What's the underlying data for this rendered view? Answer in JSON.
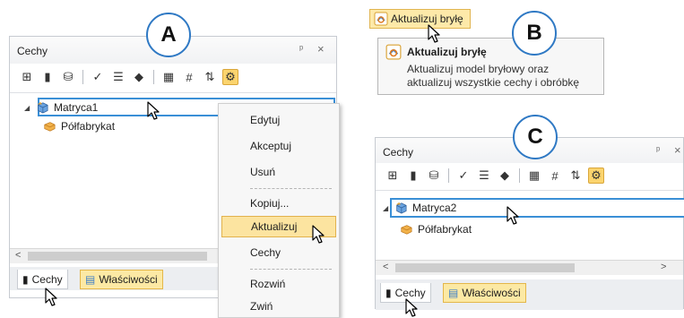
{
  "labels": {
    "a": "A",
    "b": "B",
    "c": "C"
  },
  "panel_a": {
    "title": "Cechy",
    "pin": "ᵖ",
    "close": "×",
    "tree": [
      {
        "label": "Matryca1",
        "icon": "solid-model-icon",
        "selected": true
      },
      {
        "label": "Półfabrykat",
        "icon": "blank-icon",
        "selected": false
      }
    ],
    "scroll_left": "<",
    "tabs": [
      {
        "label": "Cechy",
        "active": true
      },
      {
        "label": "Właściwości",
        "active": false
      }
    ]
  },
  "context_menu": {
    "items": [
      "Edytuj",
      "Akceptuj",
      "Usuń",
      "Kopiuj...",
      "Aktualizuj",
      "Cechy",
      "Rozwiń",
      "Zwiń"
    ],
    "highlighted": "Aktualizuj"
  },
  "button_b": {
    "label": "Aktualizuj bryłę",
    "icon": "update-solid-icon"
  },
  "tooltip": {
    "title": "Aktualizuj bryłę",
    "line1": "Aktualizuj model bryłowy oraz",
    "line2": "aktualizuj wszystkie cechy i obróbkę"
  },
  "panel_c": {
    "title": "Cechy",
    "pin": "ᵖ",
    "close": "×",
    "tree": [
      {
        "label": "Matryca2",
        "icon": "solid-model-icon",
        "selected": true
      },
      {
        "label": "Półfabrykat",
        "icon": "blank-icon",
        "selected": false
      }
    ],
    "scroll_left": "<",
    "scroll_right": ">",
    "tabs": [
      {
        "label": "Cechy",
        "active": true
      },
      {
        "label": "Właściwości",
        "active": false
      }
    ]
  },
  "colors": {
    "accent": "#3a8fd6",
    "highlight": "#fce4a0",
    "highlight_border": "#e2b24d",
    "circle_border": "#2f79c4"
  }
}
